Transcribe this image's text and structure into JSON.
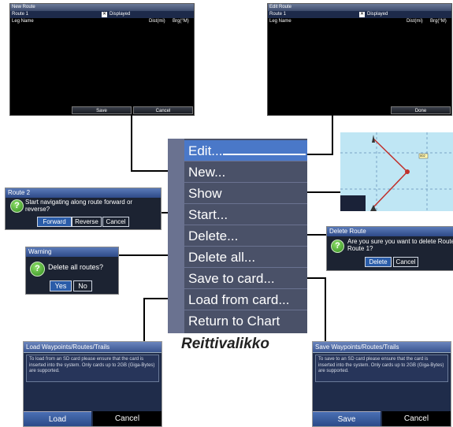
{
  "new_route": {
    "title": "New Route",
    "route_name": "Route 1",
    "displayed_label": "Displayed",
    "col_leg": "Leg Name",
    "col_dist": "Dist(mi)",
    "col_brg": "Brg(°M)",
    "save": "Save",
    "cancel": "Cancel"
  },
  "edit_route": {
    "title": "Edit Route",
    "route_name": "Route 1",
    "displayed_label": "Displayed",
    "col_leg": "Leg Name",
    "col_dist": "Dist(mi)",
    "col_brg": "Brg(°M)",
    "done": "Done"
  },
  "menu": {
    "items": [
      "Edit...",
      "New...",
      "Show",
      "Start...",
      "Delete...",
      "Delete all...",
      "Save to card...",
      "Load from card...",
      "Return to Chart"
    ]
  },
  "caption": "Reittivalikko",
  "start_dialog": {
    "title": "Route 2",
    "text": "Start navigating along route forward or reverse?",
    "forward": "Forward",
    "reverse": "Reverse",
    "cancel": "Cancel"
  },
  "warning_dialog": {
    "title": "Warning",
    "text": "Delete all routes?",
    "yes": "Yes",
    "no": "No"
  },
  "delete_dialog": {
    "title": "Delete Route",
    "text": "Are you sure you want to delete Route Route 1?",
    "delete": "Delete",
    "cancel": "Cancel"
  },
  "load_panel": {
    "title": "Load Waypoints/Routes/Trails",
    "text": "To load from an SD card please ensure that the card is inserted into the system. Only cards up to 2GB (Giga-Bytes) are supported.",
    "load": "Load",
    "cancel": "Cancel"
  },
  "save_panel": {
    "title": "Save Waypoints/Routes/Trails",
    "text": "To save to an SD card please ensure that the card is inserted into the system. Only cards up to 2GB (Giga-Bytes) are supported.",
    "save": "Save",
    "cancel": "Cancel"
  },
  "map": {
    "waypoint_label": "002"
  }
}
